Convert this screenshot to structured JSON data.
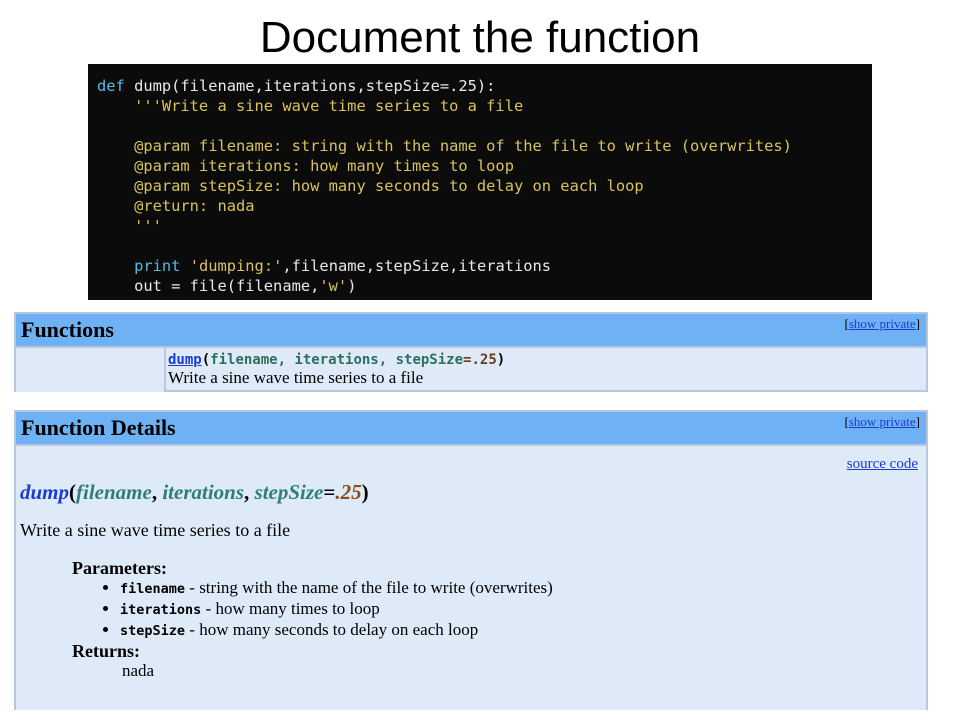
{
  "slide": {
    "title": "Document the function"
  },
  "code": {
    "lines": [
      [
        {
          "t": "def ",
          "c": "kw"
        },
        {
          "t": "dump(filename,iterations,stepSize=.25):",
          "c": "plain"
        }
      ],
      [
        {
          "t": "    '''Write a sine wave time series to a file",
          "c": "str"
        }
      ],
      [
        {
          "t": "",
          "c": "plain"
        }
      ],
      [
        {
          "t": "    @param filename: string with the name of the file to write (overwrites)",
          "c": "str"
        }
      ],
      [
        {
          "t": "    @param iterations: how many times to loop",
          "c": "str"
        }
      ],
      [
        {
          "t": "    @param stepSize: how many seconds to delay on each loop",
          "c": "str"
        }
      ],
      [
        {
          "t": "    @return: nada",
          "c": "str"
        }
      ],
      [
        {
          "t": "    '''",
          "c": "str"
        }
      ],
      [
        {
          "t": "",
          "c": "plain"
        }
      ],
      [
        {
          "t": "    ",
          "c": "plain"
        },
        {
          "t": "print ",
          "c": "kw"
        },
        {
          "t": "'dumping:'",
          "c": "str"
        },
        {
          "t": ",filename,stepSize,iterations",
          "c": "plain"
        }
      ],
      [
        {
          "t": "    out = file(filename,",
          "c": "plain"
        },
        {
          "t": "'w'",
          "c": "str"
        },
        {
          "t": ")",
          "c": "plain"
        }
      ]
    ]
  },
  "functions_section": {
    "title": "Functions",
    "show_private_open": "[",
    "show_private_label": "show private",
    "show_private_close": "]",
    "signature": {
      "name": "dump",
      "args_text": "filename, iterations, stepSize",
      "default_text": "=.25",
      "open": "(",
      "close": ")"
    },
    "description": "Write a sine wave time series to a file"
  },
  "details_section": {
    "title": "Function Details",
    "show_private_open": "[",
    "show_private_label": "show private",
    "show_private_close": "]",
    "source_code_label": "source code",
    "signature": {
      "name": "dump",
      "open": "(",
      "arg1": "filename",
      "sep1": ", ",
      "arg2": "iterations",
      "sep2": ", ",
      "arg3": "stepSize",
      "eq": "=",
      "default": ".25",
      "close": ")"
    },
    "description": "Write a sine wave time series to a file",
    "parameters_heading": "Parameters:",
    "parameters": [
      {
        "name": "filename",
        "desc": " - string with the name of the file to write (overwrites)"
      },
      {
        "name": "iterations",
        "desc": " - how many times to loop"
      },
      {
        "name": "stepSize",
        "desc": " - how many seconds to delay on each loop"
      }
    ],
    "returns_heading": "Returns:",
    "returns_value": "nada"
  },
  "colors": {
    "editor_bg": "#0b0b0b",
    "keyword": "#5bb8e6",
    "string": "#d8c35a",
    "header_bg": "#6fb1f5",
    "box_bg": "#dfeaf8",
    "link": "#1a3ccf"
  }
}
